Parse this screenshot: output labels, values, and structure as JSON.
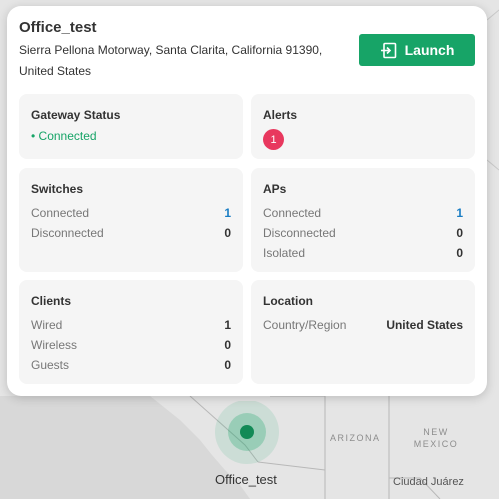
{
  "site": {
    "name": "Office_test",
    "address": "Sierra Pellona Motorway, Santa Clarita, California 91390, United States",
    "launch_label": "Launch",
    "launch_icon": "launch-icon"
  },
  "gateway": {
    "title": "Gateway Status",
    "status": "• Connected"
  },
  "alerts": {
    "title": "Alerts",
    "count": "1"
  },
  "switches": {
    "title": "Switches",
    "rows": [
      {
        "label": "Connected",
        "value": "1"
      },
      {
        "label": "Disconnected",
        "value": "0"
      }
    ]
  },
  "aps": {
    "title": "APs",
    "rows": [
      {
        "label": "Connected",
        "value": "1"
      },
      {
        "label": "Disconnected",
        "value": "0"
      },
      {
        "label": "Isolated",
        "value": "0"
      }
    ]
  },
  "clients": {
    "title": "Clients",
    "rows": [
      {
        "label": "Wired",
        "value": "1"
      },
      {
        "label": "Wireless",
        "value": "0"
      },
      {
        "label": "Guests",
        "value": "0"
      }
    ]
  },
  "location": {
    "title": "Location",
    "rows": [
      {
        "label": "Country/Region",
        "value": "United States"
      }
    ]
  },
  "map": {
    "state_arizona": "ARIZONA",
    "state_new_mexico_line1": "NEW",
    "state_new_mexico_line2": "MEXICO",
    "city": "Ciudad Juárez",
    "marker_label": "Office_test"
  },
  "colors": {
    "accent_green": "#17a467",
    "alert_red": "#e8385e",
    "link_blue": "#1a7dc4"
  }
}
